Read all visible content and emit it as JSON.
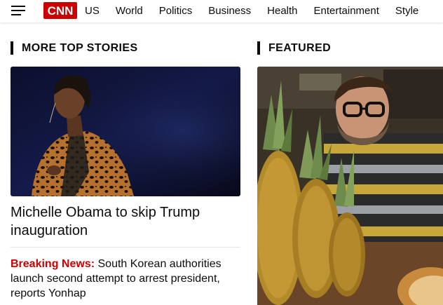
{
  "nav": {
    "brand": "CNN",
    "links": [
      "US",
      "World",
      "Politics",
      "Business",
      "Health",
      "Entertainment",
      "Style"
    ]
  },
  "sections": {
    "top_stories": "MORE TOP STORIES",
    "featured": "FEATURED"
  },
  "stories": {
    "lead_headline": "Michelle Obama to skip Trump inauguration",
    "breaking_label": "Breaking News:",
    "breaking_text": " South Korean authorities launch second attempt to arrest president, reports Yonhap"
  },
  "colors": {
    "brand_red": "#cc0000",
    "text": "#0c0c0c"
  },
  "icons": {
    "menu": "hamburger-menu-icon"
  }
}
